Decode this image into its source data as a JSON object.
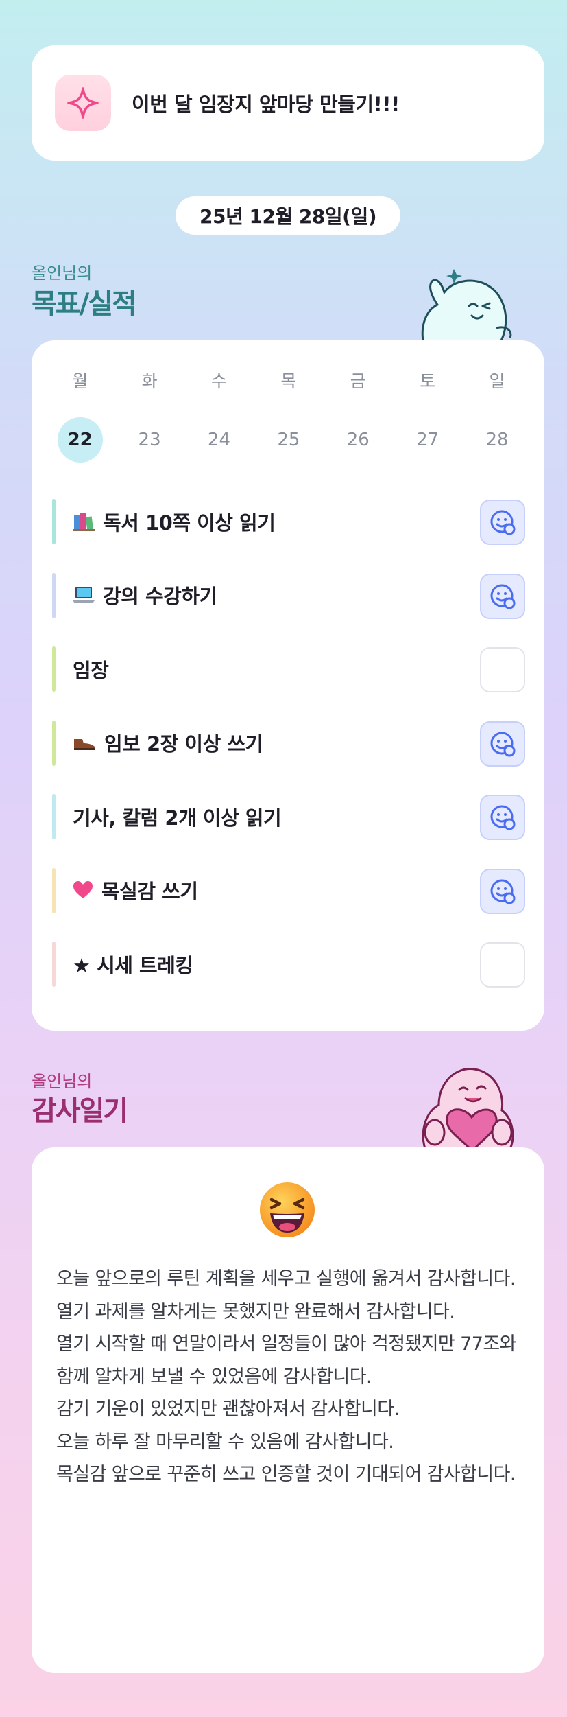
{
  "goal_banner": {
    "icon": "sparkle-icon",
    "text": "이번 달 임장지 앞마당 만들기!!!"
  },
  "date_label": "25년 12월 28일(일)",
  "goals_section": {
    "subtitle": "올인님의",
    "title": "목표/실적",
    "mascot": "waving-ghost-mascot"
  },
  "calendar": {
    "days": [
      {
        "name": "월",
        "date": "22",
        "selected": true
      },
      {
        "name": "화",
        "date": "23",
        "selected": false
      },
      {
        "name": "수",
        "date": "24",
        "selected": false
      },
      {
        "name": "목",
        "date": "25",
        "selected": false
      },
      {
        "name": "금",
        "date": "26",
        "selected": false
      },
      {
        "name": "토",
        "date": "27",
        "selected": false
      },
      {
        "name": "일",
        "date": "28",
        "selected": false
      }
    ]
  },
  "habits": [
    {
      "label": "독서 10쪽 이상 읽기",
      "emoji": "books-icon",
      "bar_color": "#a8e6dc",
      "done": true
    },
    {
      "label": "강의 수강하기",
      "emoji": "laptop-icon",
      "bar_color": "#cfd8f2",
      "done": true
    },
    {
      "label": "임장",
      "emoji": "",
      "bar_color": "#cfe89a",
      "done": false
    },
    {
      "label": "임보 2장 이상 쓰기",
      "emoji": "shoe-icon",
      "bar_color": "#cfe89a",
      "done": true
    },
    {
      "label": "기사, 칼럼 2개 이상 읽기",
      "emoji": "",
      "bar_color": "#bfeaf0",
      "done": true
    },
    {
      "label": "목실감 쓰기",
      "emoji": "heart-icon",
      "bar_color": "#f6e4b4",
      "done": true
    },
    {
      "label": "★ 시세 트레킹",
      "emoji": "",
      "bar_color": "#f6d8d8",
      "done": false
    }
  ],
  "done_icon": "smile-check-icon",
  "diary_section": {
    "subtitle": "올인님의",
    "title": "감사일기",
    "mascot": "heart-ghost-mascot"
  },
  "diary": {
    "emoji": "laughing-face-icon",
    "text": "오늘 앞으로의 루틴 계획을 세우고 실행에 옮겨서 감사합니다.\n열기 과제를 알차게는 못했지만 완료해서 감사합니다.\n열기 시작할 때 연말이라서 일정들이 많아 걱정됐지만 77조와 함께 알차게 보낼 수 있었음에 감사합니다.\n감기 기운이 있었지만 괜찮아져서 감사합니다.\n오늘 하루 잘 마무리할 수 있음에 감사합니다.\n목실감 앞으로 꾸준히 쓰고 인증할 것이 기대되어 감사합니다."
  },
  "colors": {
    "accent_teal": "#2c7e82",
    "accent_pink": "#9a2e6e",
    "check_blue": "#4a6cf0"
  }
}
